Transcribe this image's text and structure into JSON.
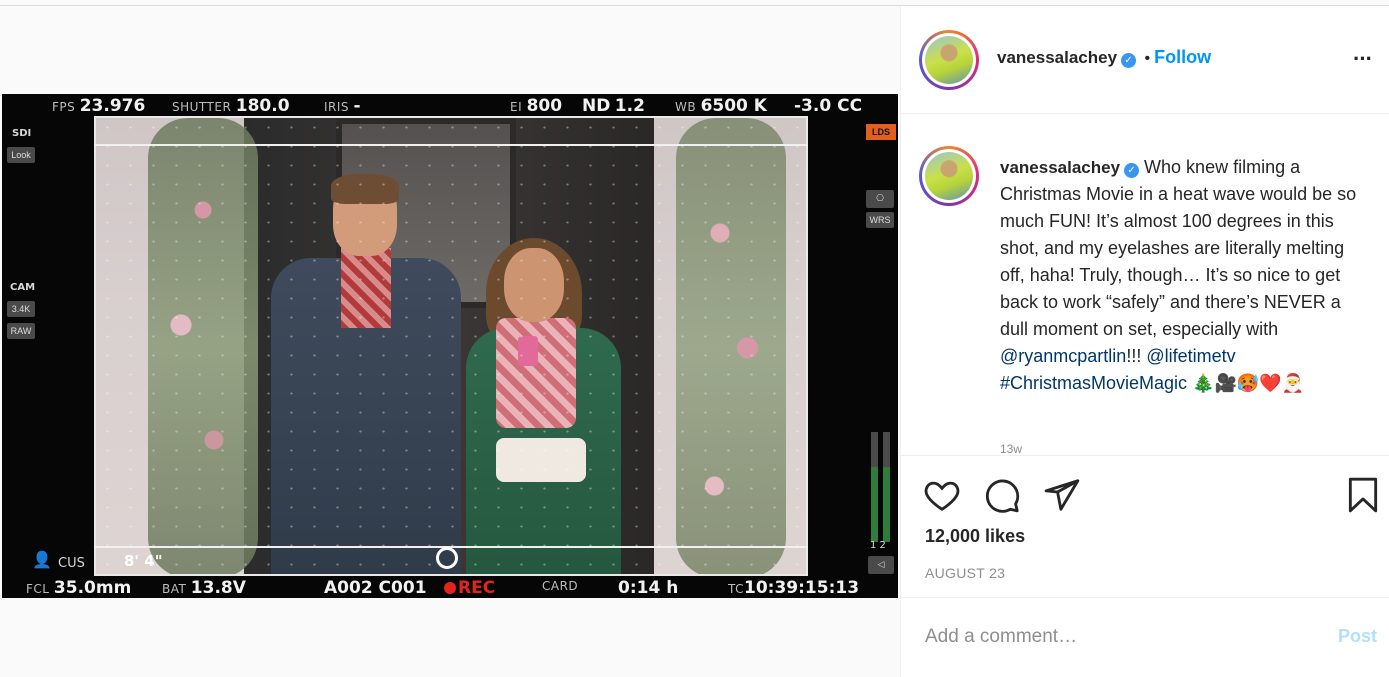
{
  "hud": {
    "fps_k": "FPS",
    "fps_v": "23.976",
    "shutter_k": "SHUTTER",
    "shutter_v": "180.0",
    "iris_k": "IRIS",
    "iris_v": "-",
    "ei_k": "EI",
    "ei_v": "800",
    "nd_k": "ND",
    "nd_v": "1.2",
    "wb_k": "WB",
    "wb_v": "6500 K",
    "cc_v": "-3.0 CC",
    "sdi": "SDI",
    "look": "Look",
    "cam": "CAM",
    "res": "3.4K",
    "raw": "RAW",
    "lds": "LDS",
    "wrs": "WRS",
    "meter_labels": "1 2",
    "cus": "CUS",
    "focus_dist": "8' 4\"",
    "fcl_k": "FCL",
    "fcl_v": "35.0mm",
    "bat_k": "BAT",
    "bat_v": "13.8V",
    "clip": "A002 C001",
    "rec": "REC",
    "card_k": "CARD",
    "card_v": "0:14 h",
    "tc_k": "TC",
    "tc_v": "10:39:15:13"
  },
  "header": {
    "username": "vanessalachey",
    "separator": "•",
    "follow_label": "Follow",
    "more_label": "•••"
  },
  "caption": {
    "username": "vanessalachey",
    "text": " Who knew filming a Christmas Movie in a heat wave would be so much FUN! It’s almost 100 degrees in this shot, and my eyelashes are literally melting off, haha! Truly, though… It’s so nice to get back to work “safely” and there’s NEVER a dull moment on set, especially with ",
    "mention1": "@ryanmcpartlin",
    "after_mention1": "!!! ",
    "mention2": "@lifetimetv",
    "hashtag": "#ChristmasMovieMagic",
    "emojis": " 🎄🎥🥵❤️🎅",
    "faint_time": "13w"
  },
  "actions": {
    "likes": "12,000 likes",
    "date": "AUGUST 23"
  },
  "comment": {
    "placeholder": "Add a comment…",
    "post_label": "Post"
  },
  "colors": {
    "accent": "#0095f6",
    "verified": "#3897f0",
    "rec": "#e3241d",
    "post_disabled": "#b2dffc"
  }
}
